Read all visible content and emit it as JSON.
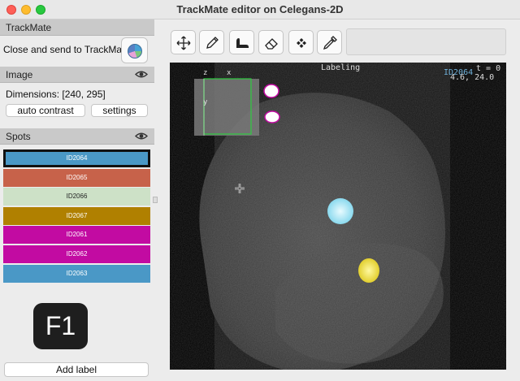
{
  "window": {
    "title": "TrackMate editor on Celegans-2D"
  },
  "trackmate": {
    "header": "TrackMate",
    "close_send_label": "Close and send to TrackMate"
  },
  "image": {
    "header": "Image",
    "dimensions": "Dimensions: [240, 295]",
    "auto_contrast_label": "auto contrast",
    "settings_label": "settings"
  },
  "spots": {
    "header": "Spots",
    "items": [
      {
        "label": "ID2064",
        "color": "#4a98c6",
        "selected": true
      },
      {
        "label": "ID2065",
        "color": "#c7624a"
      },
      {
        "label": "ID2066",
        "color": "#cde1c7"
      },
      {
        "label": "ID2067",
        "color": "#b08000"
      },
      {
        "label": "ID2061",
        "color": "#c20ba2"
      },
      {
        "label": "ID2062",
        "color": "#c20ba2"
      },
      {
        "label": "ID2063",
        "color": "#4a98c6"
      }
    ]
  },
  "keyboard": {
    "shortcut": "F1"
  },
  "add_label_button": "Add label",
  "toolbar": {
    "tools": [
      "move-icon",
      "pencil-icon",
      "bucket-icon",
      "eraser-icon",
      "delete-icon",
      "eyedropper-icon"
    ]
  },
  "viewer": {
    "labeling_text": "Labeling",
    "selected_id": "ID2064",
    "t_label": "t = 0",
    "coords": "4.6,  24.0",
    "axis_z": "z",
    "axis_x": "x",
    "axis_y": "y"
  },
  "colors": {
    "selected_cell": "#9fe7ff",
    "yellow_cell": "#f0e84a",
    "magenta_cell": "#ffffff",
    "accent": "#3c78d8"
  }
}
